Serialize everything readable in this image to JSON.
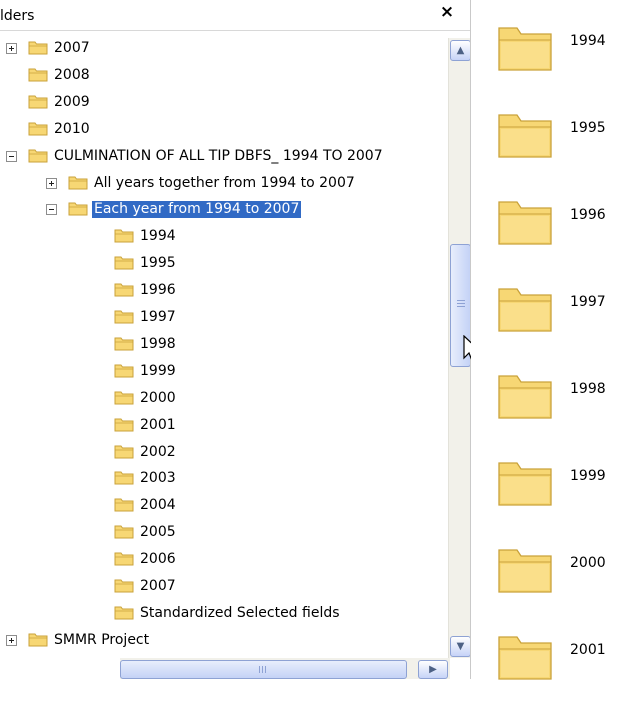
{
  "folders_pane": {
    "title": "lders",
    "close_glyph": "×",
    "tree": [
      {
        "label": "2007",
        "expander": "plus",
        "level": 0
      },
      {
        "label": "2008",
        "expander": "none",
        "level": 0
      },
      {
        "label": "2009",
        "expander": "none",
        "level": 0
      },
      {
        "label": "2010",
        "expander": "none",
        "level": 0
      },
      {
        "label": "CULMINATION OF ALL TIP DBFS_ 1994 TO 2007",
        "expander": "minus",
        "level": 0
      },
      {
        "label": "All years together from 1994 to 2007",
        "expander": "plus",
        "level": 1
      },
      {
        "label": "Each year from 1994 to 2007",
        "expander": "minus",
        "level": 1,
        "selected": true
      },
      {
        "label": "1994",
        "expander": "none",
        "level": 2
      },
      {
        "label": "1995",
        "expander": "none",
        "level": 2
      },
      {
        "label": "1996",
        "expander": "none",
        "level": 2
      },
      {
        "label": "1997",
        "expander": "none",
        "level": 2
      },
      {
        "label": "1998",
        "expander": "none",
        "level": 2
      },
      {
        "label": "1999",
        "expander": "none",
        "level": 2
      },
      {
        "label": "2000",
        "expander": "none",
        "level": 2
      },
      {
        "label": "2001",
        "expander": "none",
        "level": 2
      },
      {
        "label": "2002",
        "expander": "none",
        "level": 2
      },
      {
        "label": "2003",
        "expander": "none",
        "level": 2
      },
      {
        "label": "2004",
        "expander": "none",
        "level": 2
      },
      {
        "label": "2005",
        "expander": "none",
        "level": 2
      },
      {
        "label": "2006",
        "expander": "none",
        "level": 2
      },
      {
        "label": "2007",
        "expander": "none",
        "level": 2
      },
      {
        "label": "Standardized Selected fields",
        "expander": "none",
        "level": 2
      },
      {
        "label": "SMMR Project",
        "expander": "plus",
        "level": 0
      }
    ]
  },
  "content": {
    "folders": [
      "1994",
      "1995",
      "1996",
      "1997",
      "1998",
      "1999",
      "2000",
      "2001"
    ]
  },
  "colors": {
    "selection": "#316ac5",
    "folder_fill": "#f7d774",
    "folder_stroke": "#c9a23a"
  },
  "icons": {
    "tree_folder": "folder-icon",
    "expander_plus": "plus-box-icon",
    "expander_minus": "minus-box-icon",
    "scroll_up": "chevron-up-icon",
    "scroll_down": "chevron-down-icon",
    "scroll_right": "chevron-right-icon",
    "pointer": "mouse-pointer-icon"
  }
}
